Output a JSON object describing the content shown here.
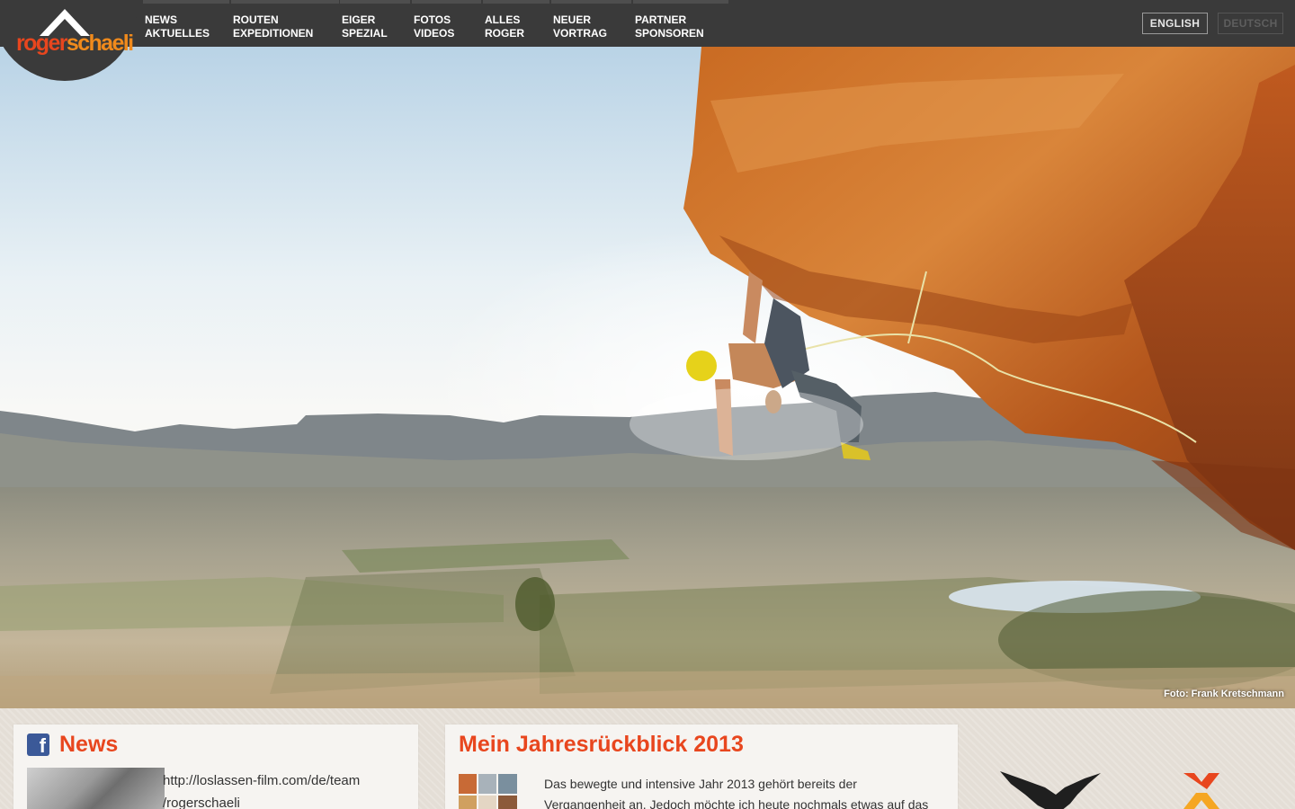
{
  "brand": {
    "logo_part1": "roger",
    "logo_part2": "schaeli",
    "colors": {
      "accent": "#e8461e",
      "accent2": "#f08a1c",
      "nav_bg": "#3a3a3a"
    }
  },
  "nav": {
    "items": [
      {
        "line1": "NEWS",
        "line2": "AKTUELLES"
      },
      {
        "line1": "ROUTEN",
        "line2": "EXPEDITIONEN"
      },
      {
        "line1": "EIGER",
        "line2": "SPEZIAL"
      },
      {
        "line1": "FOTOS",
        "line2": "VIDEOS"
      },
      {
        "line1": "ALLES",
        "line2": "ROGER"
      },
      {
        "line1": "NEUER",
        "line2": "VORTRAG"
      },
      {
        "line1": "PARTNER",
        "line2": "SPONSOREN"
      }
    ]
  },
  "languages": {
    "english": "ENGLISH",
    "deutsch": "DEUTSCH",
    "active": "english"
  },
  "hero": {
    "credit": "Foto: Frank Kretschmann"
  },
  "news": {
    "title": "News",
    "icon": "facebook-icon",
    "line1": "http://loslassen-film.com/de/team",
    "line2": "/rogerschaeli"
  },
  "article": {
    "title": "Mein Jahresrückblick 2013",
    "line1": "Das bewegte und intensive Jahr 2013 gehört bereits der",
    "line2": "Vergangenheit an. Jedoch möchte ich heute nochmals etwas auf das"
  },
  "sponsors": [
    "eagle-logo-icon",
    "x-logo-icon"
  ]
}
